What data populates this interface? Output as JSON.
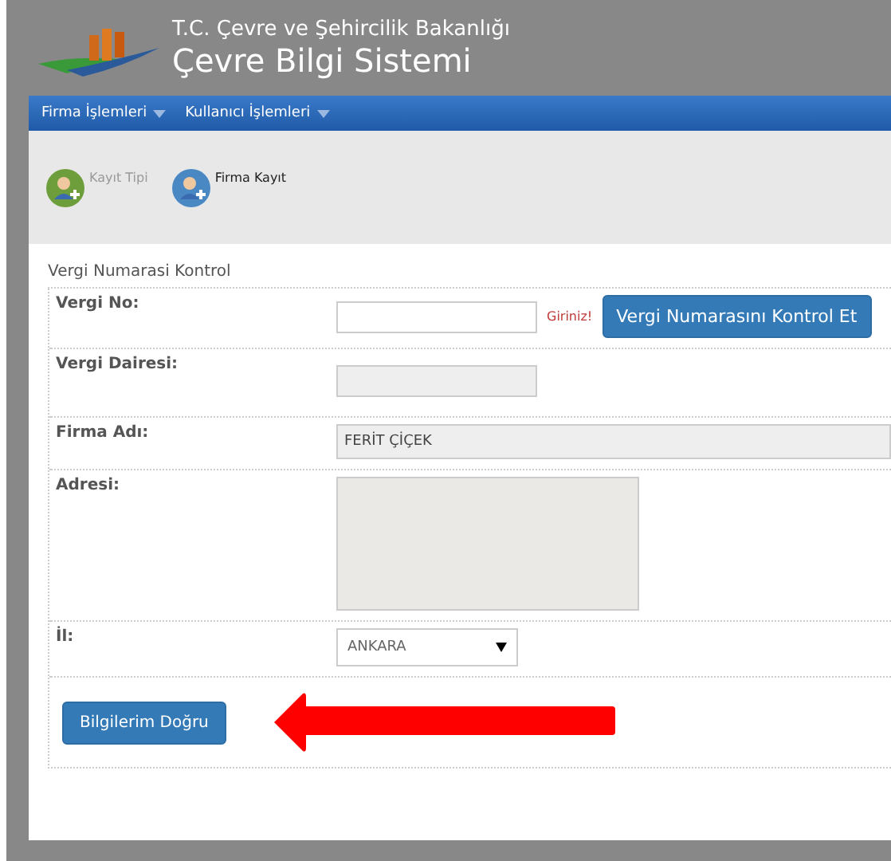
{
  "header": {
    "ministry": "T.C. Çevre ve Şehircilik Bakanlığı",
    "system": "Çevre Bilgi Sistemi"
  },
  "nav": [
    {
      "label": "Firma İşlemleri"
    },
    {
      "label": "Kullanıcı İşlemleri"
    }
  ],
  "steps": [
    {
      "label": "Kayıt Tipi",
      "selected": false,
      "color": "#6e9e3c"
    },
    {
      "label": "Firma Kayıt",
      "selected": true,
      "color": "#4a88c4"
    }
  ],
  "form": {
    "title": "Vergi Numarasi Kontrol",
    "rows": [
      {
        "kind": "check",
        "label": "Vergi No:",
        "hint": "Giriniz!",
        "button": "Vergi Numarasını Kontrol Et"
      },
      {
        "kind": "readonly",
        "label": "Vergi Dairesi:"
      },
      {
        "kind": "wide",
        "label": "Firma Adı:",
        "value": "FERİT ÇİÇEK"
      },
      {
        "kind": "textarea",
        "label": "Adresi:"
      },
      {
        "kind": "select",
        "label": "İl:",
        "value": "ANKARA"
      }
    ],
    "submit": "Bilgilerim Doğru"
  }
}
